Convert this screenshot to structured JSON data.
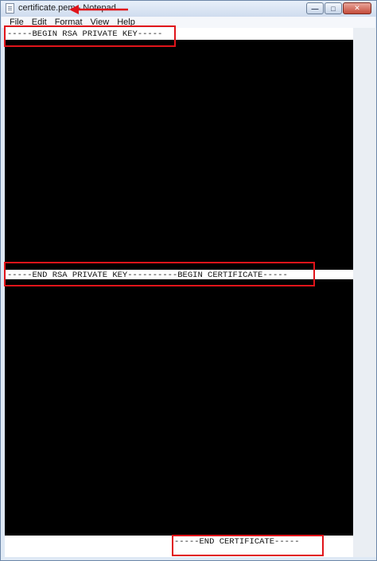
{
  "window": {
    "title": "certificate.pem - Notepad",
    "minimize_glyph": "—",
    "maximize_glyph": "□",
    "close_glyph": "✕"
  },
  "menu": {
    "items": [
      "File",
      "Edit",
      "Format",
      "View",
      "Help"
    ]
  },
  "document": {
    "line_begin_key": "-----BEGIN RSA PRIVATE KEY-----",
    "line_end_key_begin_cert": "-----END RSA PRIVATE KEY----------BEGIN CERTIFICATE-----",
    "line_end_cert": "-----END CERTIFICATE-----"
  },
  "annotations": {
    "color": "#e0141a",
    "arrow_icon": "left-arrow-icon"
  }
}
